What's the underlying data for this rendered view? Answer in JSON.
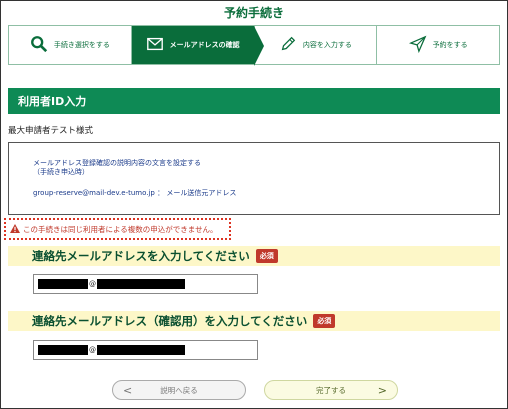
{
  "header": {
    "title": "予約手続き"
  },
  "steps": [
    {
      "label": "手続き選択をする",
      "icon": "search-icon"
    },
    {
      "label": "メールアドレスの確認",
      "icon": "envelope-icon"
    },
    {
      "label": "内容を入力する",
      "icon": "pencil-icon"
    },
    {
      "label": "予約をする",
      "icon": "send-icon"
    }
  ],
  "section": {
    "title": "利用者ID入力"
  },
  "form": {
    "name": "最大申請者テスト様式"
  },
  "notice": {
    "line1": "メールアドレス登録確認の説明内容の文言を設定する",
    "line2": "（手続き申込時）",
    "sender_address": "group-reserve@mail-dev.e-tumo.jp",
    "sender_sep": "：",
    "sender_label": "メール送信元アドレス"
  },
  "warning": {
    "text": "この手続きは同じ利用者による複数の申込ができません。"
  },
  "email": {
    "label": "連絡先メールアドレスを入力してください",
    "required": "必須",
    "value_at": "@"
  },
  "email_confirm": {
    "label": "連絡先メールアドレス（確認用）を入力してください",
    "required": "必須",
    "value_at": "@"
  },
  "buttons": {
    "back": "説明へ戻る",
    "done": "完了する",
    "back_arrow": "<",
    "done_arrow": ">"
  },
  "colors": {
    "brand_green": "#0a6d3b",
    "section_green": "#0e8a55",
    "required_red": "#c0392b"
  }
}
